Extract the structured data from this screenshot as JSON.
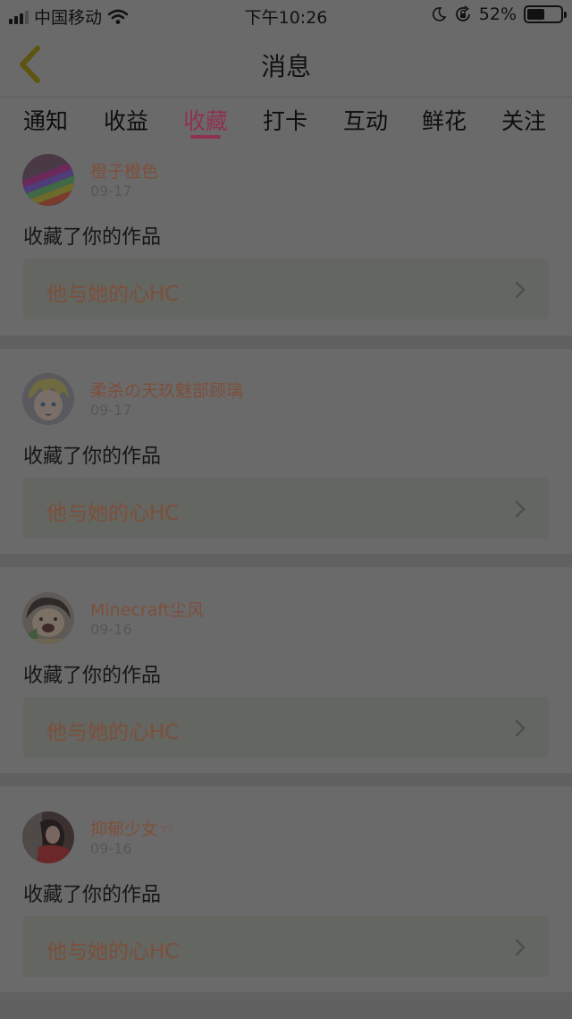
{
  "status_bar": {
    "carrier": "中国移动",
    "time": "下午10:26",
    "battery_text": "52%",
    "battery_level": 0.52,
    "icons": [
      "signal-icon",
      "wifi-icon",
      "moon-icon",
      "rotation-lock-icon",
      "battery-icon"
    ]
  },
  "nav": {
    "title": "消息",
    "back_icon": "chevron-left-icon"
  },
  "tabs": [
    {
      "label": "通知"
    },
    {
      "label": "收益"
    },
    {
      "label": "收藏"
    },
    {
      "label": "打卡"
    },
    {
      "label": "互动"
    },
    {
      "label": "鲜花"
    },
    {
      "label": "关注"
    }
  ],
  "active_tab": "收藏",
  "items": [
    {
      "name": "橙子橙色",
      "date": "09-17",
      "action": "收藏了你的作品",
      "work": "他与她的心HC"
    },
    {
      "name": "柔杀の天玖魅部顾璃",
      "date": "09-17",
      "action": "收藏了你的作品",
      "work": "他与她的心HC"
    },
    {
      "name": "Minecraft尘风",
      "date": "09-16",
      "action": "收藏了你的作品",
      "work": "他与她的心HC"
    },
    {
      "name": "抑郁少女☜",
      "date": "09-16",
      "action": "收藏了你的作品",
      "work": "他与她的心HC"
    }
  ],
  "colors": {
    "overlay_bg": "#6b6a6a",
    "accent": "#8f3153",
    "username": "#7d4f3b",
    "work_card_bg": "#636661"
  }
}
